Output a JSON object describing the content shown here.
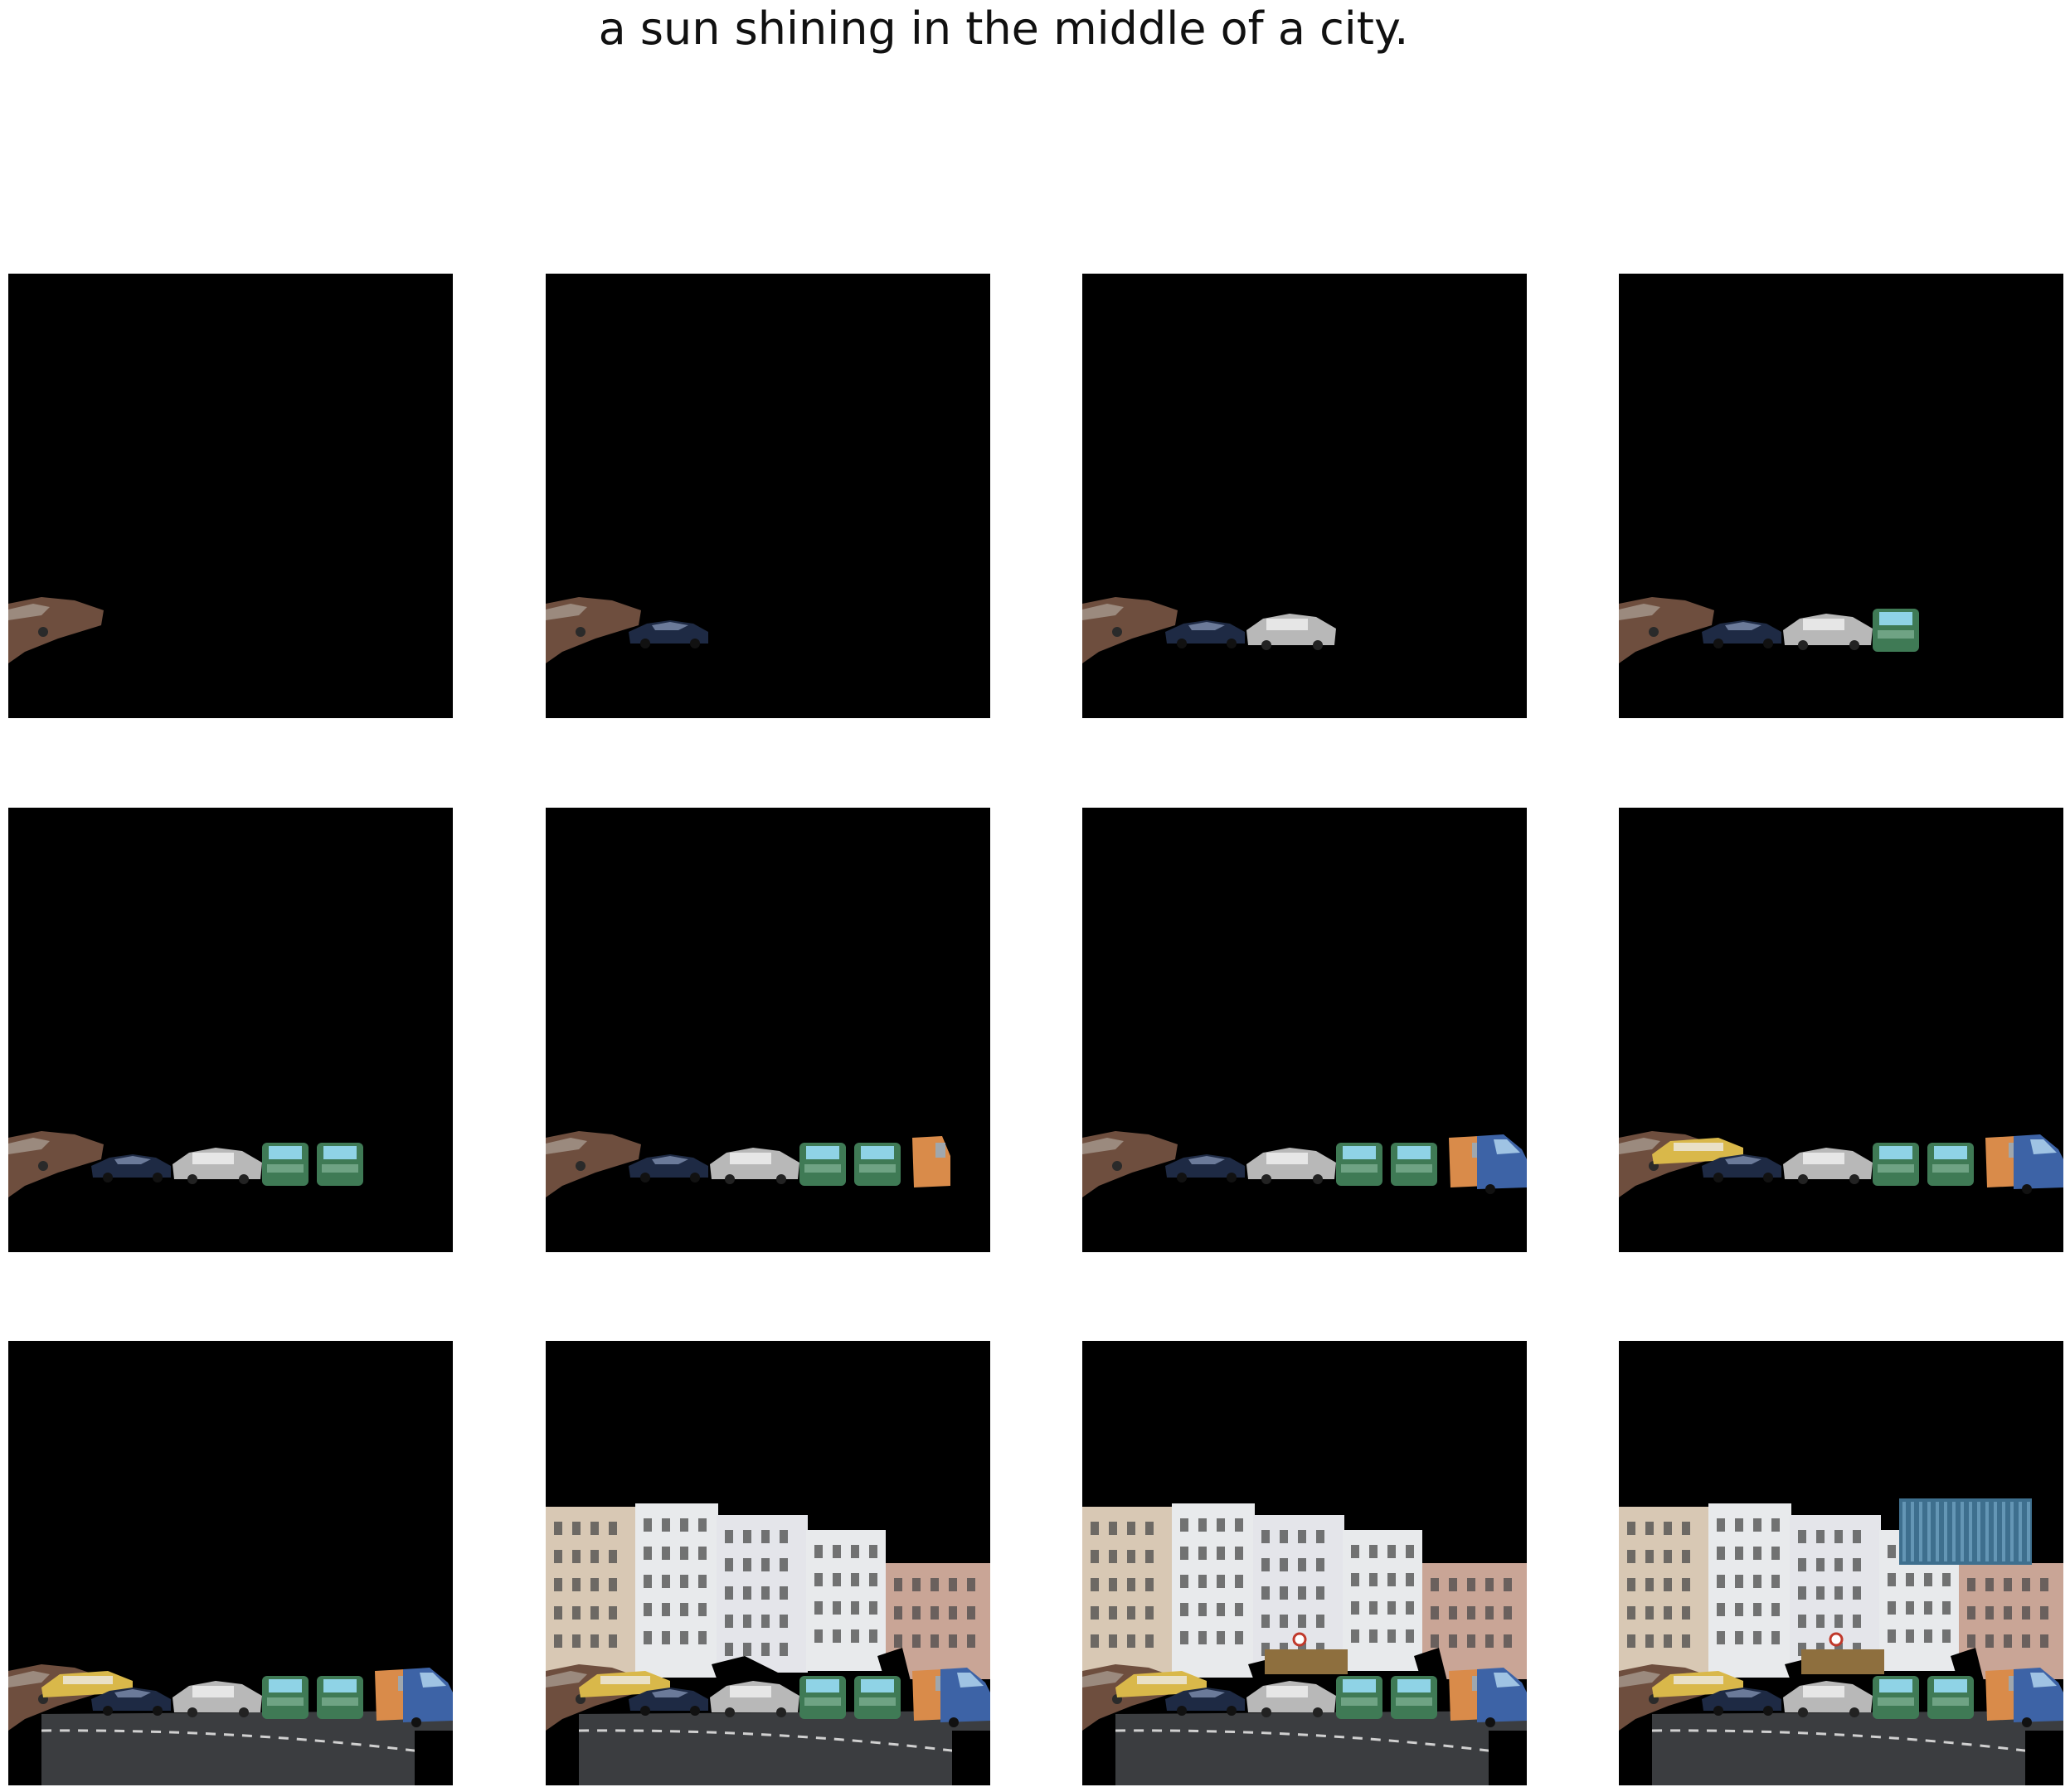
{
  "title": "a sun shining in the middle of a city.",
  "grid": {
    "rows": 3,
    "cols": 4
  },
  "panels": [
    {
      "step": 1,
      "layers": [
        "car-brown"
      ]
    },
    {
      "step": 2,
      "layers": [
        "car-brown",
        "car-dark-blue"
      ]
    },
    {
      "step": 3,
      "layers": [
        "car-brown",
        "car-dark-blue",
        "car-silver"
      ]
    },
    {
      "step": 4,
      "layers": [
        "car-brown",
        "car-dark-blue",
        "car-silver",
        "car-green-1"
      ]
    },
    {
      "step": 5,
      "layers": [
        "car-brown",
        "car-dark-blue",
        "car-silver",
        "car-green-1",
        "car-green-2"
      ]
    },
    {
      "step": 6,
      "layers": [
        "car-brown",
        "car-dark-blue",
        "car-silver",
        "car-green-1",
        "car-green-2",
        "van-orange"
      ]
    },
    {
      "step": 7,
      "layers": [
        "car-brown",
        "car-dark-blue",
        "car-silver",
        "car-green-1",
        "car-green-2",
        "van-orange",
        "van-blue"
      ]
    },
    {
      "step": 8,
      "layers": [
        "car-brown",
        "car-dark-blue",
        "car-silver",
        "car-green-1",
        "car-green-2",
        "van-orange",
        "van-blue",
        "car-yellow"
      ]
    },
    {
      "step": 9,
      "layers": [
        "car-brown",
        "car-dark-blue",
        "car-silver",
        "car-green-1",
        "car-green-2",
        "van-orange",
        "van-blue",
        "car-yellow",
        "road"
      ]
    },
    {
      "step": 10,
      "layers": [
        "car-brown",
        "car-dark-blue",
        "car-silver",
        "car-green-1",
        "car-green-2",
        "van-orange",
        "van-blue",
        "car-yellow",
        "road",
        "buildings"
      ]
    },
    {
      "step": 11,
      "layers": [
        "car-brown",
        "car-dark-blue",
        "car-silver",
        "car-green-1",
        "car-green-2",
        "van-orange",
        "van-blue",
        "car-yellow",
        "road",
        "buildings",
        "tram-sign"
      ]
    },
    {
      "step": 12,
      "layers": [
        "car-brown",
        "car-dark-blue",
        "car-silver",
        "car-green-1",
        "car-green-2",
        "van-orange",
        "van-blue",
        "car-yellow",
        "road",
        "buildings",
        "tram-sign",
        "skyscraper"
      ]
    }
  ],
  "colors": {
    "background": "#000000",
    "car_brown": "#6e4e3e",
    "car_dark_blue": "#1e2a44",
    "car_silver": "#b8b8b8",
    "car_green": "#3f7a55",
    "van_orange": "#d98b4a",
    "van_blue": "#3d63a6",
    "car_yellow": "#d9b84a",
    "road": "#3b3d40",
    "building_beige": "#d8c8b4",
    "building_white": "#e8eaec",
    "building_pink": "#c9a596",
    "skyscraper": "#3e6f8e"
  }
}
